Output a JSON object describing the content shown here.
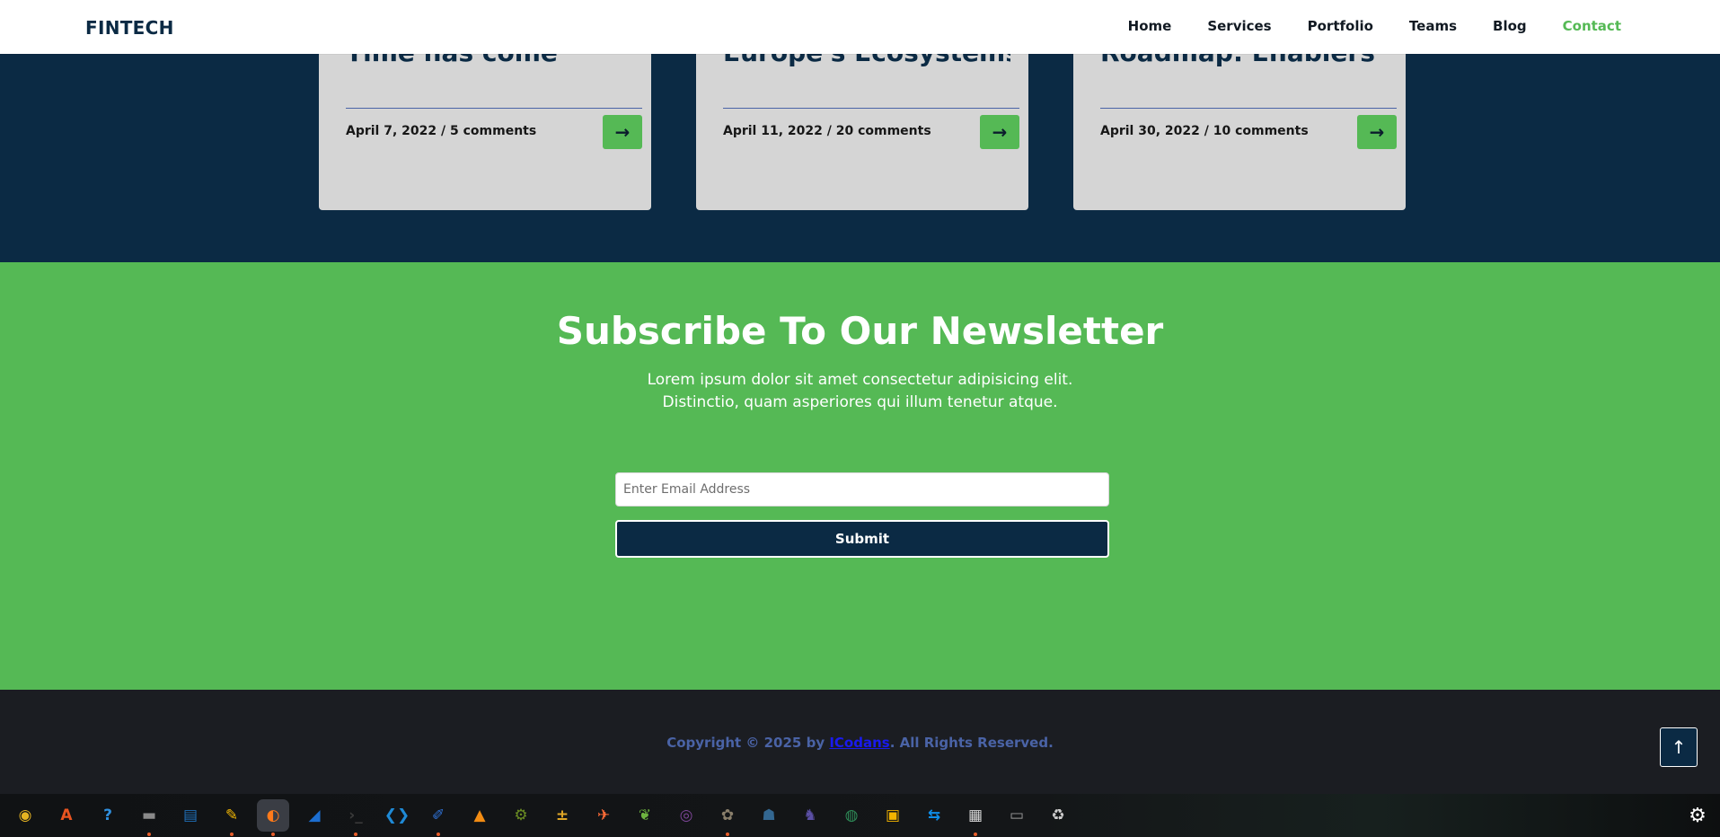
{
  "header": {
    "brand": "FINTECH",
    "nav": [
      "Home",
      "Services",
      "Portfolio",
      "Teams",
      "Blog",
      "Contact"
    ],
    "active": "Contact"
  },
  "blog": {
    "cards": [
      {
        "title": "Time has come",
        "meta": "April 7, 2022 / 5 comments"
      },
      {
        "title": "Europe's Ecosystems",
        "meta": "April 11, 2022 / 20 comments"
      },
      {
        "title": "Roadmap: Enablers",
        "meta": "April 30, 2022 / 10 comments"
      }
    ]
  },
  "newsletter": {
    "title": "Subscribe To Our Newsletter",
    "description": "Lorem ipsum dolor sit amet consectetur adipisicing elit. Distinctio, quam asperiores qui illum tenetur atque.",
    "email_placeholder": "Enter Email Address",
    "submit_label": "Submit"
  },
  "footer": {
    "copyright_prefix": "Copyright © 2025 by ",
    "copyright_link": "ICodans",
    "copyright_suffix": ". All Rights Reserved."
  },
  "dock": {
    "apps": [
      {
        "icon": "rhythmbox-icon",
        "glyph": "◉",
        "color": "#e6b422"
      },
      {
        "icon": "app-center-icon",
        "glyph": "A",
        "color": "#e95420"
      },
      {
        "icon": "help-icon",
        "glyph": "?",
        "color": "#2f8fde"
      },
      {
        "icon": "files-icon",
        "glyph": "▬",
        "color": "#8a8a8a",
        "running": true
      },
      {
        "icon": "document-viewer-icon",
        "glyph": "▤",
        "color": "#1f6fb8"
      },
      {
        "icon": "text-editor-icon",
        "glyph": "✎",
        "color": "#f2b705",
        "running": true
      },
      {
        "icon": "firefox-icon",
        "glyph": "◐",
        "color": "#ff7a1a",
        "running": true,
        "active": true
      },
      {
        "icon": "wireshark-icon",
        "glyph": "◢",
        "color": "#1c6ed0"
      },
      {
        "icon": "terminal-icon",
        "glyph": "›_",
        "color": "#3a3a3a",
        "running": true
      },
      {
        "icon": "vscode-icon",
        "glyph": "❮❯",
        "color": "#1f8ad6"
      },
      {
        "icon": "notes-icon",
        "glyph": "✐",
        "color": "#2f73d9",
        "running": true
      },
      {
        "icon": "vlc-icon",
        "glyph": "▲",
        "color": "#f28c13"
      },
      {
        "icon": "disk-tools-icon",
        "glyph": "⚙",
        "color": "#6b8e23"
      },
      {
        "icon": "calculator-icon",
        "glyph": "±",
        "color": "#e0a626"
      },
      {
        "icon": "postman-icon",
        "glyph": "✈",
        "color": "#ff6c37"
      },
      {
        "icon": "spring-icon",
        "glyph": "❦",
        "color": "#6db33f"
      },
      {
        "icon": "tor-icon",
        "glyph": "◎",
        "color": "#7d4698"
      },
      {
        "icon": "gimp-icon",
        "glyph": "✿",
        "color": "#8a7f6b",
        "running": true
      },
      {
        "icon": "postgresql-icon",
        "glyph": "☗",
        "color": "#336791"
      },
      {
        "icon": "unicorn-icon",
        "glyph": "♞",
        "color": "#5b4fa5"
      },
      {
        "icon": "camera-icon",
        "glyph": "◍",
        "color": "#2e8b57"
      },
      {
        "icon": "image-viewer-icon",
        "glyph": "▣",
        "color": "#f4b400"
      },
      {
        "icon": "teamviewer-icon",
        "glyph": "⇆",
        "color": "#0e8ee9"
      },
      {
        "icon": "screenshot-icon",
        "glyph": "▦",
        "color": "#d9d9d9",
        "running": true
      },
      {
        "icon": "ssd-icon",
        "glyph": "▭",
        "color": "#9a9a9a"
      },
      {
        "icon": "trash-icon",
        "glyph": "♻",
        "color": "#cfcfcf"
      }
    ]
  }
}
